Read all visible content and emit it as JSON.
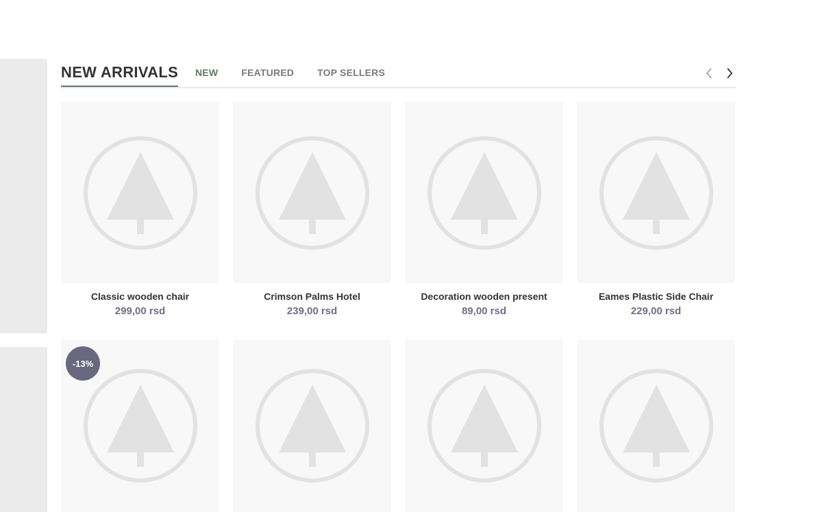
{
  "section": {
    "title": "NEW ARRIVALS",
    "tabs": [
      {
        "label": "NEW",
        "active": true
      },
      {
        "label": "FEATURED",
        "active": false
      },
      {
        "label": "TOP SELLERS",
        "active": false
      }
    ]
  },
  "icons": {
    "prev": "chevron-left-icon",
    "next": "chevron-right-icon",
    "placeholder": "tree-placeholder-icon"
  },
  "colors": {
    "accent": "#5f7a63",
    "price": "#6e6e85",
    "badge": "#68687e",
    "placeholder": "#e2e2e2"
  },
  "products_row1": [
    {
      "name": "Classic wooden chair",
      "price": "299,00 rsd"
    },
    {
      "name": "Crimson Palms Hotel",
      "price": "239,00 rsd"
    },
    {
      "name": "Decoration wooden present",
      "price": "89,00 rsd"
    },
    {
      "name": "Eames Plastic Side Chair",
      "price": "229,00 rsd"
    }
  ],
  "products_row2": [
    {
      "badge": "-13%"
    },
    {},
    {},
    {}
  ]
}
